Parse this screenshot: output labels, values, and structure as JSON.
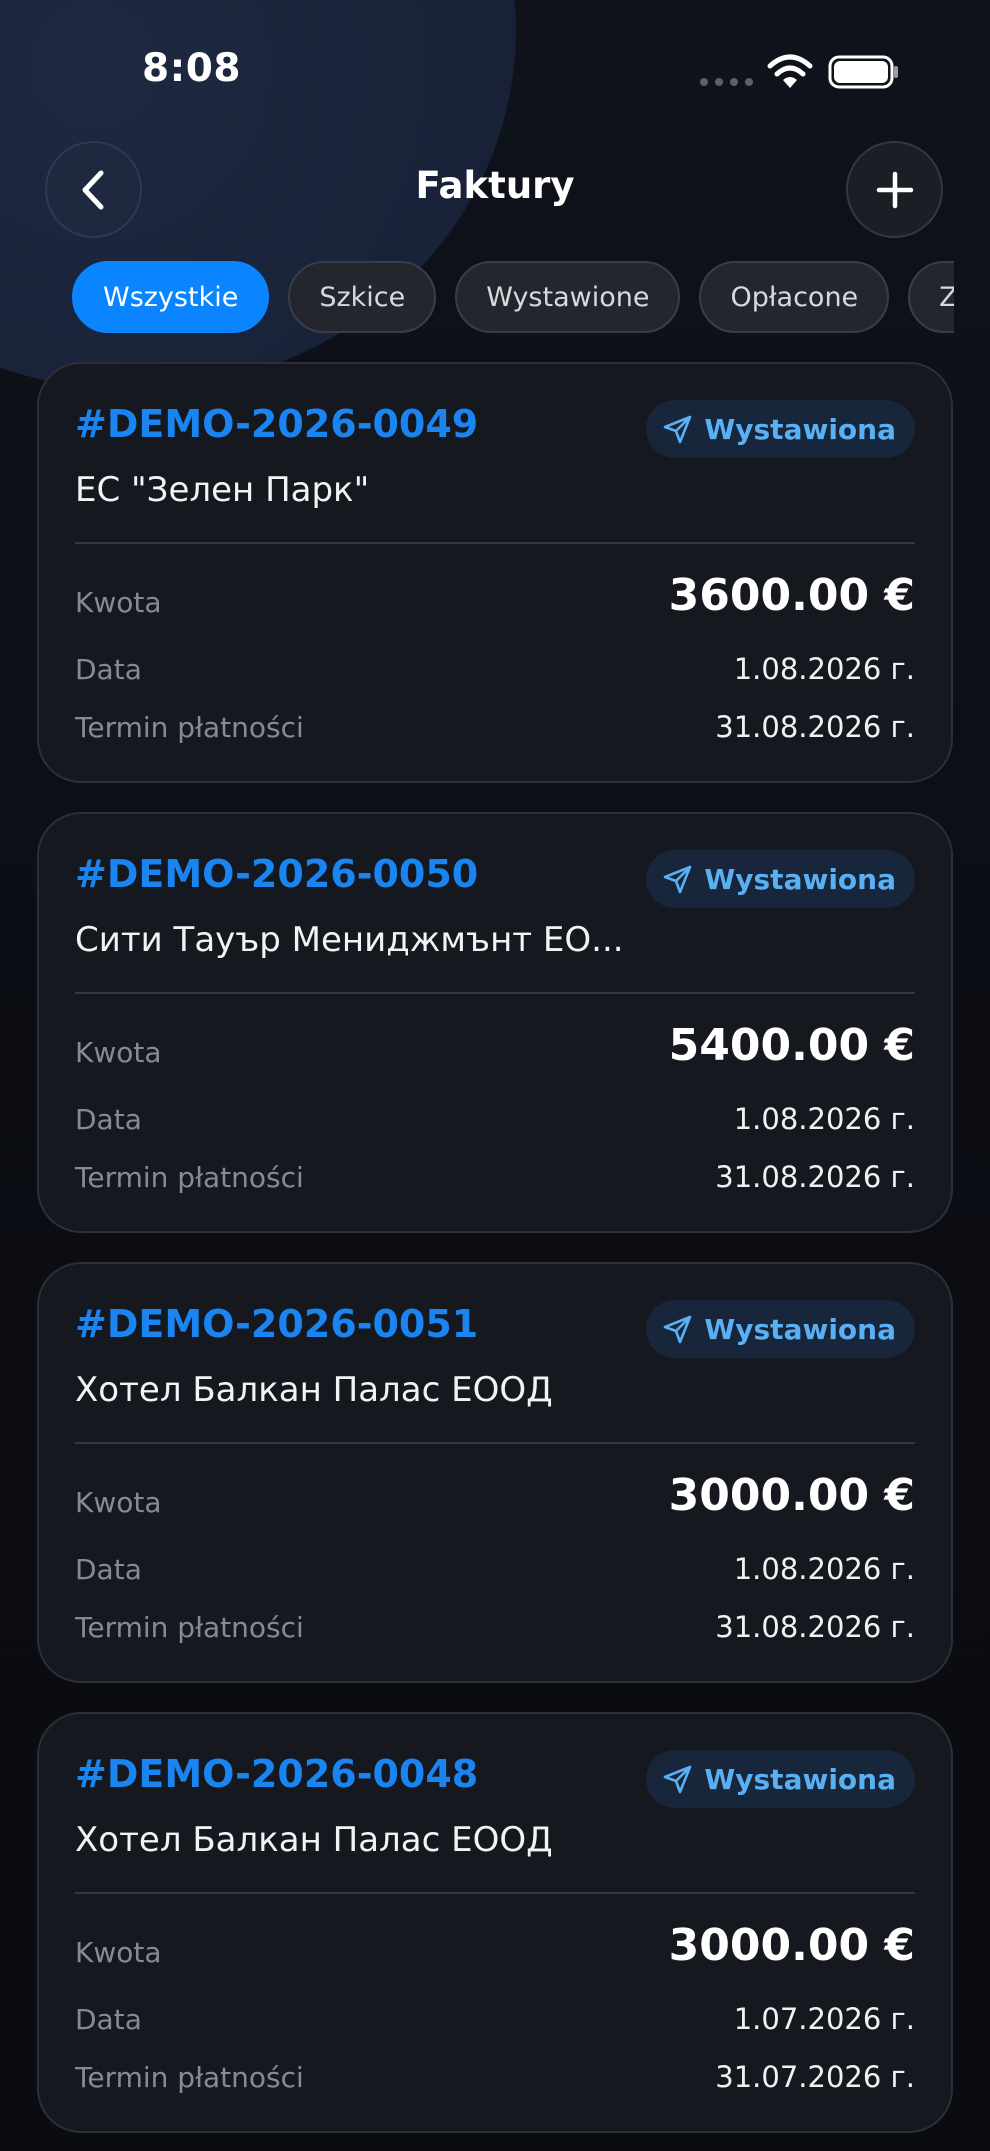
{
  "status_bar": {
    "time": "8:08"
  },
  "header": {
    "title": "Faktury",
    "back_icon": "chevron-left-icon",
    "add_icon": "plus-icon"
  },
  "filters": {
    "active": "Wszystkie",
    "items": [
      "Wszystkie",
      "Szkice",
      "Wystawione",
      "Opłacone",
      "Zaległe"
    ]
  },
  "labels": {
    "amount": "Kwota",
    "date": "Data",
    "due_date": "Termin płatności"
  },
  "colors": {
    "accent": "#0a84ff",
    "invoice_number": "#1a84f0",
    "badge_text": "#5ab0f5",
    "badge_bg": "#17263a",
    "card_bg": "#16181f"
  },
  "invoices": [
    {
      "number": "#DEMO-2026-0049",
      "status": "Wystawiona",
      "status_icon": "paper-plane-icon",
      "client": "ЕС \"Зелен Парк\"",
      "amount": "3600.00 €",
      "date": "1.08.2026 г.",
      "due_date": "31.08.2026 г."
    },
    {
      "number": "#DEMO-2026-0050",
      "status": "Wystawiona",
      "status_icon": "paper-plane-icon",
      "client": "Сити Тауър Мениджмънт ЕО...",
      "amount": "5400.00 €",
      "date": "1.08.2026 г.",
      "due_date": "31.08.2026 г."
    },
    {
      "number": "#DEMO-2026-0051",
      "status": "Wystawiona",
      "status_icon": "paper-plane-icon",
      "client": "Хотел Балкан Палас ЕООД",
      "amount": "3000.00 €",
      "date": "1.08.2026 г.",
      "due_date": "31.08.2026 г."
    },
    {
      "number": "#DEMO-2026-0048",
      "status": "Wystawiona",
      "status_icon": "paper-plane-icon",
      "client": "Хотел Балкан Палас ЕООД",
      "amount": "3000.00 €",
      "date": "1.07.2026 г.",
      "due_date": "31.07.2026 г."
    }
  ]
}
